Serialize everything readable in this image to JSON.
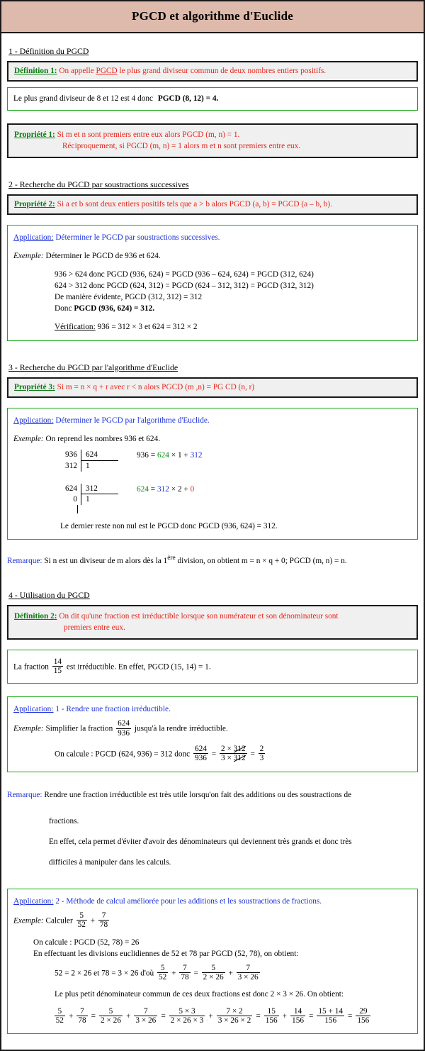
{
  "document": {
    "title": "PGCD et algorithme d'Euclide",
    "colors": {
      "header_bg": "#ddbaab",
      "definition_label": "#0a7a12",
      "definition_text": "#e8241a",
      "application_label": "#1a30d8",
      "box_green_border": "#17a817",
      "box_grey_bg": "#f0f0f0"
    }
  },
  "sections": {
    "s1": {
      "heading": "1 - Définition du PGCD",
      "definition1": {
        "label": "Définition 1:",
        "text_before": "On appelle",
        "keyword": "PGCD",
        "text_after": "le plus grand diviseur commun de deux nombres entiers positifs."
      },
      "example": {
        "text": "Le plus grand diviseur de 8 et 12 est 4 donc",
        "result": "PGCD (8, 12) = 4."
      },
      "propriete1": {
        "label": "Propriété 1:",
        "line1": "Si  m  et  n  sont premiers entre eux alors  PGCD (m, n) = 1.",
        "line2": "Réciproquement, si  PGCD (m, n) = 1 alors m  et  n  sont premiers entre eux."
      }
    },
    "s2": {
      "heading": "2 - Recherche du PGCD par soustractions successives",
      "propriete2": {
        "label": "Propriété 2:",
        "line1": "Si  a  et  b  sont deux entiers positifs tels que  a > b  alors  PGCD (a, b) = PGCD (a – b, b)."
      },
      "application": {
        "label": "Application:",
        "text": "Déterminer le PGCD par soustractions successives.",
        "example_label": "Exemple:",
        "example_text": "Déterminer le PGCD de 936 et 624.",
        "steps": [
          "936 > 624 donc  PGCD (936, 624) = PGCD (936 – 624, 624) = PGCD (312, 624)",
          "624 > 312 donc  PGCD (624, 312) = PGCD (624 – 312, 312) = PGCD (312, 312)",
          "De manière évidente, PGCD (312, 312) = 312"
        ],
        "conclusion_prefix": "Donc",
        "conclusion_bold": "PGCD (936, 624) = 312.",
        "verification_label": "Vérification:",
        "verification_text": "936 = 312 × 3  et  624 = 312 × 2"
      }
    },
    "s3": {
      "heading": "3 - Recherche du PGCD par l'algorithme d'Euclide",
      "propriete3": {
        "label": "Propriété 3:",
        "line1": "Si m = n × q + r  avec r < n alors PGCD (m ,n) = PG CD (n, r)"
      },
      "application": {
        "label": "Application:",
        "text": "Déterminer le PGCD par l'algorithme d'Euclide.",
        "example_label": "Exemple:",
        "example_text": "On reprend les nombres 936 et 624.",
        "division1": {
          "dividend": "936",
          "divisor": "624",
          "remainder": "312",
          "quotient": "1",
          "equation_a": "936 = ",
          "equation_b": "624",
          "equation_c": " × 1 + ",
          "equation_d": "312"
        },
        "division2": {
          "dividend": "624",
          "divisor": "312",
          "remainder": "0",
          "quotient": "1",
          "equation_a": "624",
          "equation_b": " = ",
          "equation_c": "312",
          "equation_d": " × 2 + ",
          "equation_e": "0"
        },
        "conclusion": "Le dernier reste non nul est le PGCD donc  PGCD (936, 624) = 312."
      },
      "remarque": {
        "label": "Remarque:",
        "text_a": "Si  n  est un diviseur de  m  alors dès la 1",
        "sup": "ère",
        "text_b": " division, on obtient  m = n × q + 0;  PGCD (m, n) = n."
      }
    },
    "s4": {
      "heading": "4 - Utilisation du PGCD",
      "definition2": {
        "label": "Définition 2:",
        "line1": "On dit qu'une fraction est irréductible lorsque son numérateur et son dénominateur sont",
        "line2": "premiers entre eux."
      },
      "example_fraction": {
        "text_a": "La fraction",
        "num": "14",
        "den": "15",
        "text_b": "est irréductible. En effet, PGCD (15, 14) = 1."
      },
      "application1": {
        "label": "Application:",
        "text": "1 - Rendre une fraction irréductible.",
        "example_label": "Exemple:",
        "example_a": "Simplifier la fraction",
        "frac_num": "624",
        "frac_den": "936",
        "example_b": "jusqu'à la rendre irréductible.",
        "calc_text": "On calcule :  PGCD (624, 936) = 312  donc",
        "f1_num": "624",
        "f1_den": "936",
        "eq1": "=",
        "f2_num_a": "2 ×",
        "f2_num_b": "312",
        "f2_den_a": "3 ×",
        "f2_den_b": "312",
        "eq2": "=",
        "f3_num": "2",
        "f3_den": "3"
      },
      "remarque": {
        "label": "Remarque:",
        "line1": "Rendre une fraction irréductible est très utile lorsqu'on fait des additions ou des soustractions de",
        "line2": "fractions.",
        "line3": "En effet, cela permet d'éviter d'avoir des dénominateurs qui deviennent très grands et donc très",
        "line4": "difficiles à manipuler dans les calculs."
      },
      "application2": {
        "label": "Application:",
        "text": "2 - Méthode de calcul améliorée pour les additions et les soustractions de fractions.",
        "example_label": "Exemple:",
        "example_text": "Calculer",
        "e_f1_num": "5",
        "e_f1_den": "52",
        "e_plus": "+",
        "e_f2_num": "7",
        "e_f2_den": "78",
        "calc_line1": "On calcule : PGCD (52, 78) = 26",
        "calc_line2": "En effectuant les divisions euclidiennes de 52 et 78 par PGCD (52, 78), on obtient:",
        "line3_a": "52 = 2 × 26  et  78 = 3 × 26  d'où",
        "l3_f1_num": "5",
        "l3_f1_den": "52",
        "l3_f2_num": "7",
        "l3_f2_den": "78",
        "l3_f3_num": "5",
        "l3_f3_den": "2 × 26",
        "l3_f4_num": "7",
        "l3_f4_den": "3 × 26",
        "lcd_text": "Le plus petit dénominateur commun de ces deux fractions est donc 2 × 3 × 26. On obtient:",
        "final": [
          {
            "num": "5",
            "den": "52",
            "op": "+"
          },
          {
            "num": "7",
            "den": "78",
            "op": "="
          },
          {
            "num": "5",
            "den": "2 × 26",
            "op": "+"
          },
          {
            "num": "7",
            "den": "3 × 26",
            "op": "="
          },
          {
            "num": "5 × 3",
            "den": "2 × 26 × 3",
            "op": "+"
          },
          {
            "num": "7 × 2",
            "den": "3 × 26 × 2",
            "op": "="
          },
          {
            "num": "15",
            "den": "156",
            "op": "+"
          },
          {
            "num": "14",
            "den": "156",
            "op": "="
          },
          {
            "num": "15 + 14",
            "den": "156",
            "op": "="
          },
          {
            "num": "29",
            "den": "156",
            "op": ""
          }
        ]
      }
    }
  }
}
